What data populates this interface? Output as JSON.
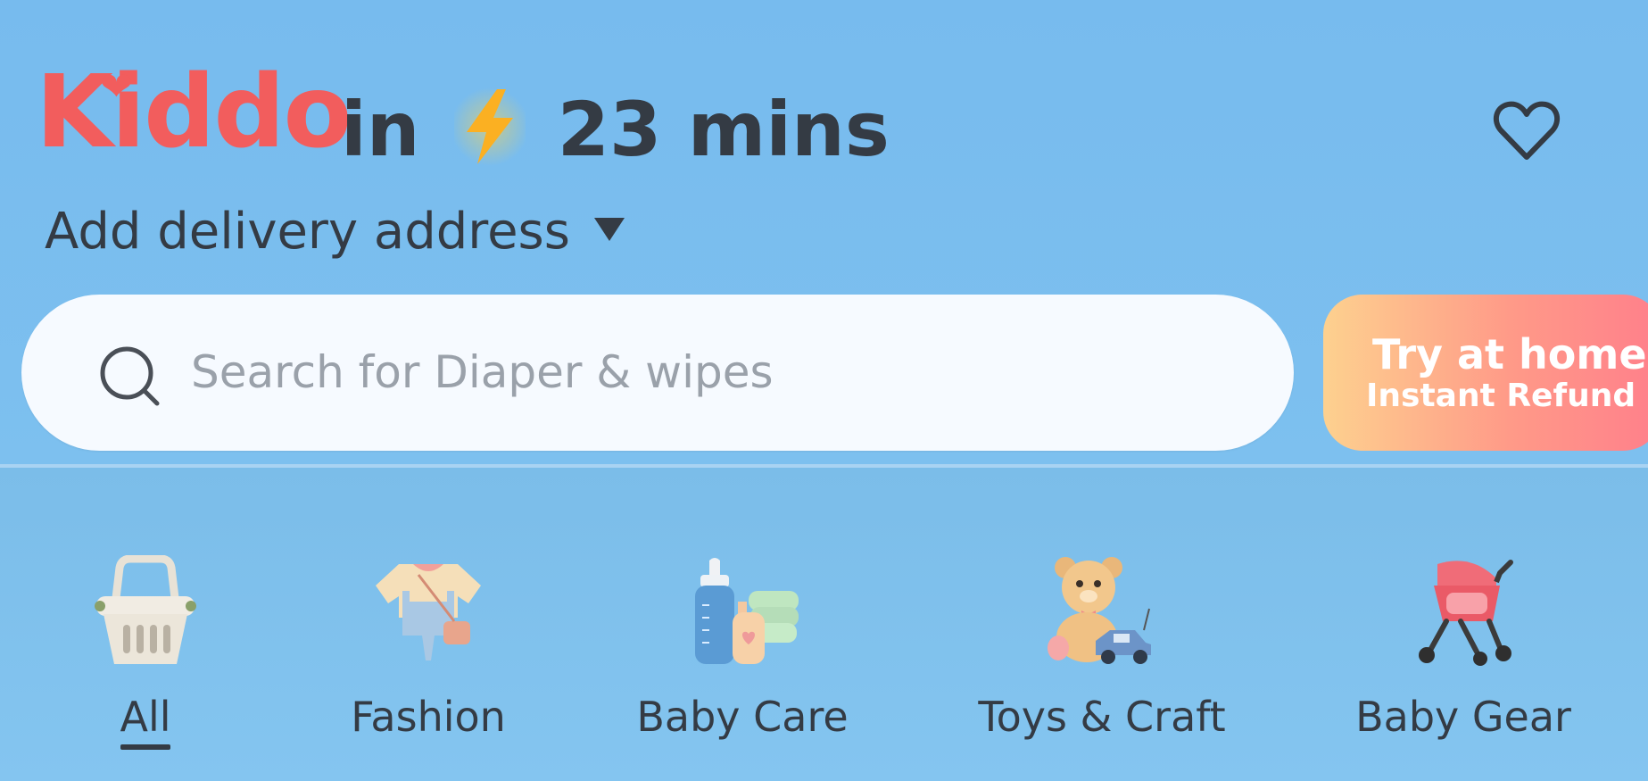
{
  "brand": {
    "name": "Kiddo",
    "color": "#f25d5d"
  },
  "delivery": {
    "prefix": "in",
    "time": "23 mins",
    "bolt_icon": "lightning-bolt-icon"
  },
  "wishlist": {
    "icon": "heart-outline-icon"
  },
  "address": {
    "label": "Add delivery address",
    "icon": "caret-down-icon"
  },
  "search": {
    "placeholder": "Search for Diaper & wipes",
    "icon": "search-icon"
  },
  "promo": {
    "line1": "Try at home",
    "line2": "Instant Refund"
  },
  "categories": [
    {
      "label": "All",
      "icon": "basket-icon",
      "selected": true
    },
    {
      "label": "Fashion",
      "icon": "baby-romper-icon",
      "selected": false
    },
    {
      "label": "Baby Care",
      "icon": "baby-bottle-icon",
      "selected": false
    },
    {
      "label": "Toys & Craft",
      "icon": "teddy-bear-icon",
      "selected": false
    },
    {
      "label": "Baby Gear",
      "icon": "stroller-icon",
      "selected": false
    }
  ],
  "colors": {
    "background": "#7bbde9",
    "text": "#343b44",
    "accent": "#f25d5d"
  }
}
